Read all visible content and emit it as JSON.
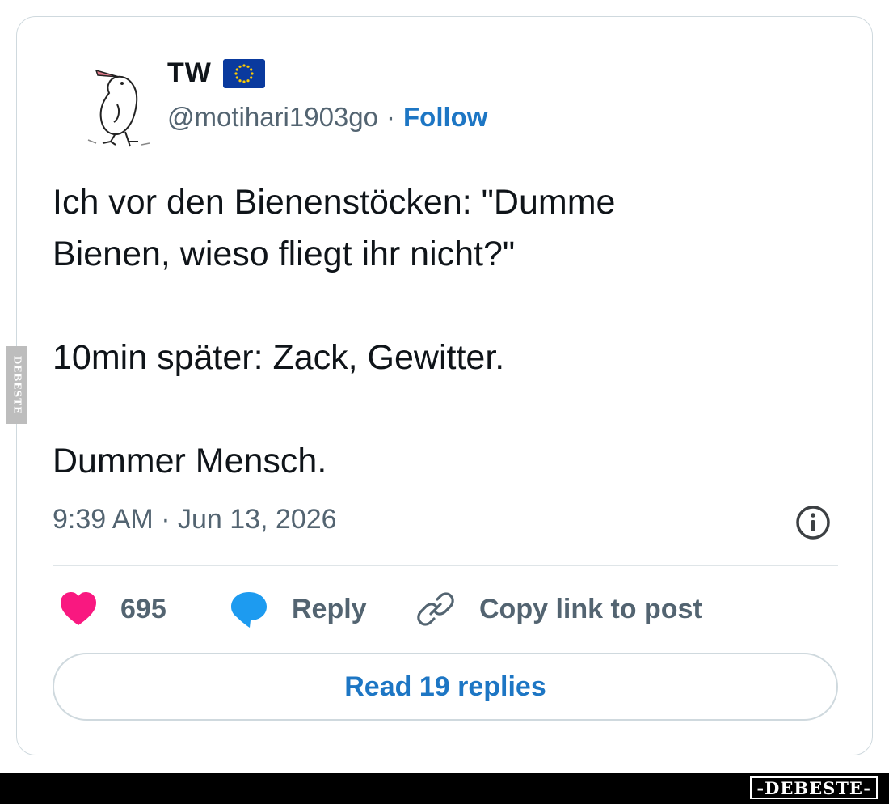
{
  "author": {
    "display_name": "TW",
    "handle": "@motihari1903go",
    "separator": "·",
    "follow_label": "Follow",
    "badge_icon": "eu-flag-icon"
  },
  "tweet": {
    "lines": [
      "Ich vor den Bienenstöcken: \"Dumme",
      "Bienen, wieso fliegt ihr nicht?\"",
      "10min später: Zack, Gewitter.",
      "Dummer Mensch."
    ],
    "timestamp": "9:39 AM · Jun 13, 2026"
  },
  "actions": {
    "like_count": "695",
    "reply_label": "Reply",
    "copy_label": "Copy link to post"
  },
  "read_replies_label": "Read 19 replies",
  "watermarks": {
    "side": "DEBESTE",
    "bottom": "-DEBESTE-"
  },
  "colors": {
    "link_blue": "#1d76c4",
    "like_pink": "#f91880",
    "reply_blue": "#1d9bf0",
    "muted_gray": "#536471",
    "eu_blue": "#0a3a9e",
    "eu_gold": "#ffcc00"
  }
}
